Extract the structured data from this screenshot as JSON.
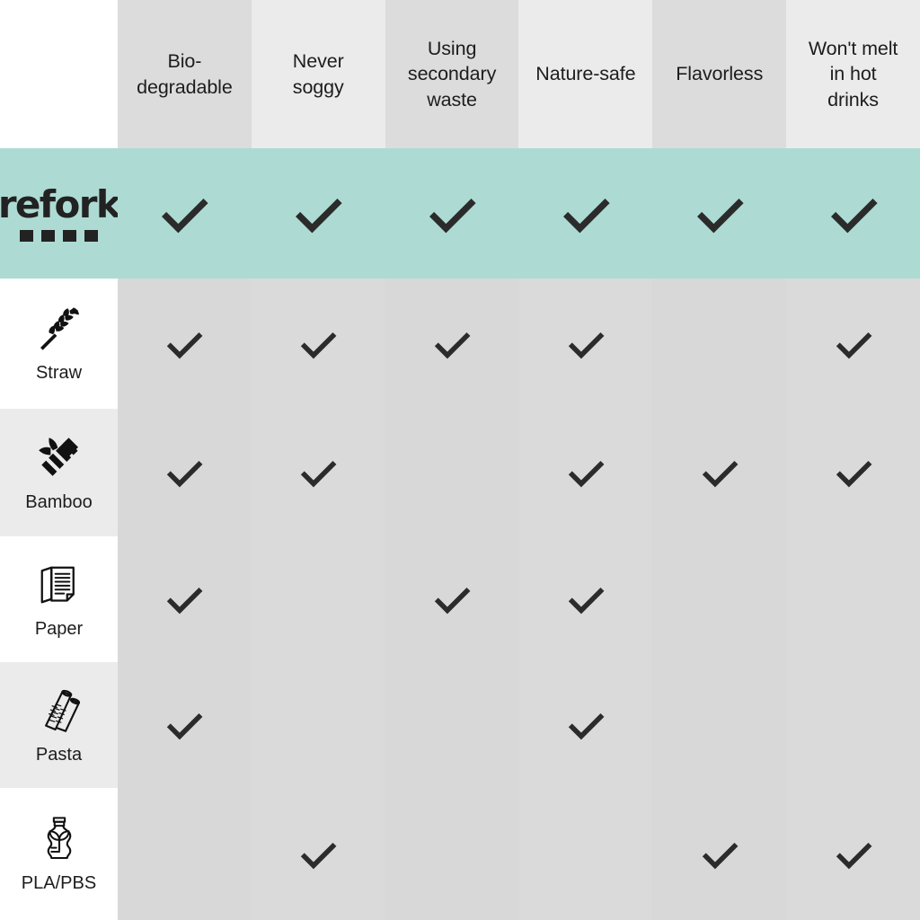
{
  "comparison": {
    "corner_label": "",
    "columns": [
      {
        "label": "Bio-\ndegradable",
        "shade": "dark"
      },
      {
        "label": "Never\nsoggy",
        "shade": "light"
      },
      {
        "label": "Using\nsecondary\nwaste",
        "shade": "dark"
      },
      {
        "label": "Nature-safe",
        "shade": "light"
      },
      {
        "label": "Flavorless",
        "shade": "dark"
      },
      {
        "label": "Won't melt\nin hot\ndrinks",
        "shade": "light"
      }
    ],
    "rows": [
      {
        "label": "refork",
        "icon": "refork-logo",
        "highlight": true,
        "checks": [
          true,
          true,
          true,
          true,
          true,
          true
        ]
      },
      {
        "label": "Straw",
        "icon": "wheat-icon",
        "highlight": false,
        "checks": [
          true,
          true,
          true,
          true,
          false,
          true
        ]
      },
      {
        "label": "Bamboo",
        "icon": "bamboo-icon",
        "highlight": false,
        "checks": [
          true,
          true,
          false,
          true,
          true,
          true
        ]
      },
      {
        "label": "Paper",
        "icon": "paper-sheets-icon",
        "highlight": false,
        "checks": [
          true,
          false,
          true,
          true,
          false,
          false
        ]
      },
      {
        "label": "Pasta",
        "icon": "pasta-icon",
        "highlight": false,
        "checks": [
          true,
          false,
          false,
          true,
          false,
          false
        ]
      },
      {
        "label": "PLA/PBS",
        "icon": "bioplastic-bottle-icon",
        "highlight": false,
        "checks": [
          false,
          true,
          false,
          false,
          true,
          true
        ]
      }
    ],
    "colors": {
      "highlight": "#addbd4",
      "header_dark": "#dcdcdc",
      "header_light": "#ebebeb",
      "cell": "#d8d8d8",
      "label_alt": "#ebebeb",
      "text": "#1d1d1d",
      "check": "#2b2b2b"
    }
  }
}
